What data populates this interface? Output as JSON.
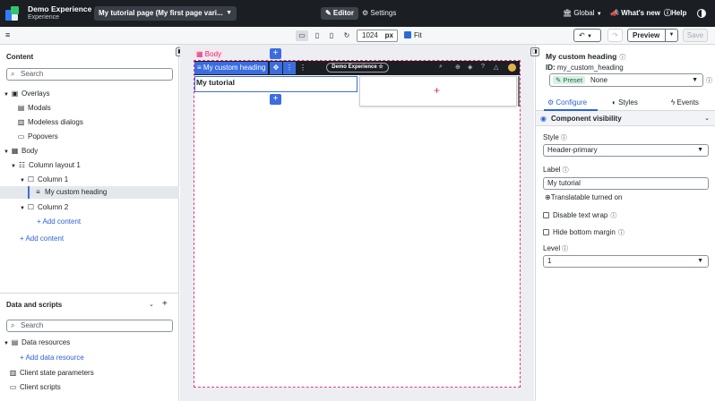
{
  "app": {
    "title": "Demo Experience",
    "subtitle": "Experience",
    "page_select": "My tutorial page (My first page vari...",
    "editor_tab": "Editor",
    "settings_tab": "Settings",
    "global": "Global",
    "whats_new": "What's new",
    "help": "Help"
  },
  "toolbar": {
    "width_value": "1024",
    "width_unit": "px",
    "fit_label": "Fit",
    "fit_checked": true,
    "preview_label": "Preview",
    "save_label": "Save"
  },
  "content_panel": {
    "title": "Content",
    "search_placeholder": "Search",
    "tree": [
      {
        "label": "Overlays",
        "level": 0,
        "icon": "overlay-icon",
        "expanded": true
      },
      {
        "label": "Modals",
        "level": 1,
        "icon": "modal-icon"
      },
      {
        "label": "Modeless dialogs",
        "level": 1,
        "icon": "dialog-icon"
      },
      {
        "label": "Popovers",
        "level": 1,
        "icon": "popover-icon"
      },
      {
        "label": "Body",
        "level": 0,
        "icon": "grid-icon",
        "expanded": true
      },
      {
        "label": "Column layout 1",
        "level": 1,
        "icon": "columns-icon",
        "expanded": true
      },
      {
        "label": "Column 1",
        "level": 2,
        "icon": "box-icon",
        "expanded": true
      },
      {
        "label": "My custom heading",
        "level": 3,
        "icon": "heading-icon",
        "selected": true
      },
      {
        "label": "Column 2",
        "level": 2,
        "icon": "box-icon",
        "expanded": true
      },
      {
        "label": "Add content",
        "level": 3,
        "add": true
      },
      {
        "label": "Add content",
        "level": 1,
        "add": true
      }
    ]
  },
  "data_panel": {
    "title": "Data and scripts",
    "search_placeholder": "Search",
    "data_resources": "Data resources",
    "add_data_resource": "Add data resource",
    "client_state": "Client state parameters",
    "client_scripts": "Client scripts"
  },
  "canvas": {
    "body_tag": "Body",
    "nav_pill": "Demo Experience",
    "selected_component": "My custom heading",
    "heading_text": "My tutorial"
  },
  "properties": {
    "title": "My custom heading",
    "id_label": "ID:",
    "id_value": "my_custom_heading",
    "preset_badge": "Preset",
    "preset_value": "None",
    "tabs": [
      "Configure",
      "Styles",
      "Events"
    ],
    "section": "Component visibility",
    "style_label": "Style",
    "style_value": "Header-primary",
    "label_label": "Label",
    "label_value": "My tutorial",
    "translatable": "Translatable turned on",
    "disable_wrap": "Disable text wrap",
    "hide_margin": "Hide bottom margin",
    "level_label": "Level",
    "level_value": "1"
  },
  "colors": {
    "topbar": "#1b1e23",
    "accent": "#3b6de0",
    "link": "#2d62d8",
    "body_highlight": "#e0397d"
  }
}
